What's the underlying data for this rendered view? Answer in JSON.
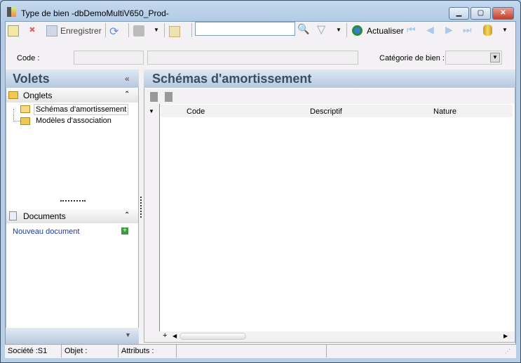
{
  "window": {
    "title": "Type de bien -dbDemoMultiV650_Prod-"
  },
  "toolbar": {
    "save_label": "Enregistrer",
    "search_value": "",
    "refresh_label": "Actualiser"
  },
  "form": {
    "code_label": "Code :",
    "category_label": "Catégorie de bien :"
  },
  "left_pane": {
    "title": "Volets",
    "tabs_section": "Onglets",
    "tabs": [
      "Schémas d'amortissement",
      "Modèles d'association"
    ],
    "documents_section": "Documents",
    "new_document": "Nouveau document"
  },
  "main": {
    "title": "Schémas d'amortissement",
    "columns": [
      "Code",
      "Descriptif",
      "Nature"
    ]
  },
  "statusbar": {
    "company": "Société :S1",
    "object": "Objet :",
    "attributes": "Attributs :"
  }
}
